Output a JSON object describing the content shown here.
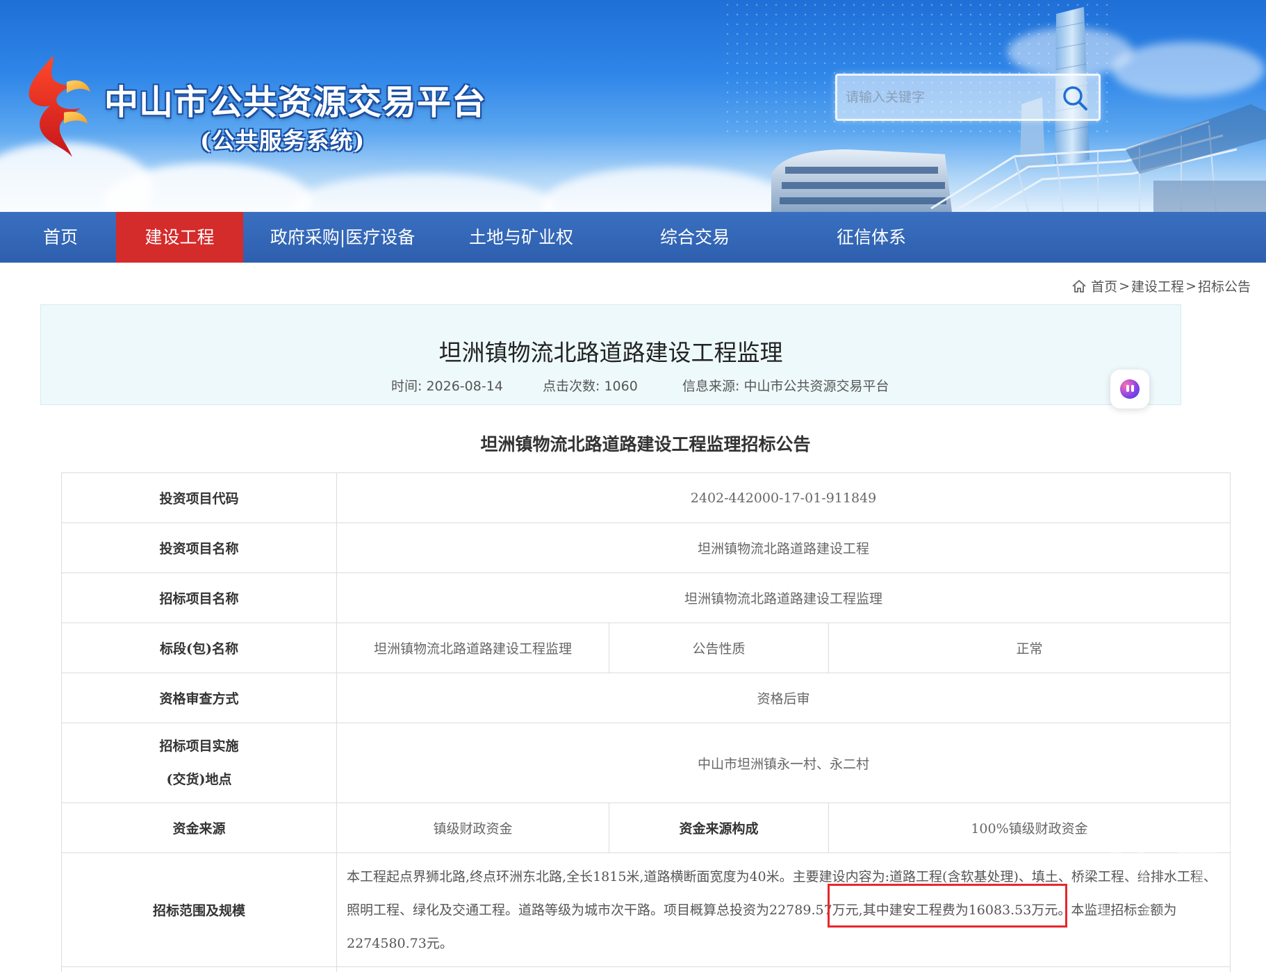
{
  "site": {
    "title": "中山市公共资源交易平台",
    "subtitle": "(公共服务系统)"
  },
  "search": {
    "placeholder": "请输入关键字"
  },
  "nav": {
    "items": [
      {
        "label": "首页",
        "active": false
      },
      {
        "label": "建设工程",
        "active": true
      },
      {
        "label": "政府采购|医疗设备",
        "active": false
      },
      {
        "label": "土地与矿业权",
        "active": false
      },
      {
        "label": "综合交易",
        "active": false
      },
      {
        "label": "征信体系",
        "active": false
      }
    ]
  },
  "breadcrumb": {
    "items": [
      "首页",
      "建设工程",
      "招标公告"
    ],
    "separator": ">"
  },
  "article": {
    "title": "坦洲镇物流北路道路建设工程监理",
    "time_label": "时间:",
    "time_value": "2026-08-14",
    "clicks_label": "点击次数:",
    "clicks_value": "1060",
    "source_label": "信息来源:",
    "source_value": "中山市公共资源交易平台"
  },
  "notice": {
    "title": "坦洲镇物流北路道路建设工程监理招标公告",
    "rows": {
      "project_code": {
        "label": "投资项目代码",
        "value": "2402-442000-17-01-911849"
      },
      "project_name": {
        "label": "投资项目名称",
        "value": "坦洲镇物流北路道路建设工程"
      },
      "tender_name": {
        "label": "招标项目名称",
        "value": "坦洲镇物流北路道路建设工程监理"
      },
      "section": {
        "label": "标段(包)名称",
        "value": "坦洲镇物流北路道路建设工程监理",
        "label2": "公告性质",
        "value2": "正常"
      },
      "qualification": {
        "label": "资格审查方式",
        "value": "资格后审"
      },
      "location": {
        "label_line1": "招标项目实施",
        "label_line2": "(交货)地点",
        "value": "中山市坦洲镇永一村、永二村"
      },
      "funding": {
        "label": "资金来源",
        "value": "镇级财政资金",
        "label2": "资金来源构成",
        "value2": "100%镇级财政资金"
      },
      "scope": {
        "label": "招标范围及规模",
        "value": "本工程起点界狮北路,终点环洲东北路,全长1815米,道路横断面宽度为40米。主要建设内容为:道路工程(含软基处理)、填土、桥梁工程、给排水工程、照明工程、绿化及交通工程。道路等级为城市次干路。项目概算总投资为22789.57万元,其中建安工程费为16083.53万元。本监理招标金额为2274580.73元。"
      }
    }
  },
  "colors": {
    "nav_bg": "#2e5fae",
    "nav_active": "#d42b2b",
    "title_card_bg": "#eef9fc",
    "highlight": "#e8262d"
  }
}
